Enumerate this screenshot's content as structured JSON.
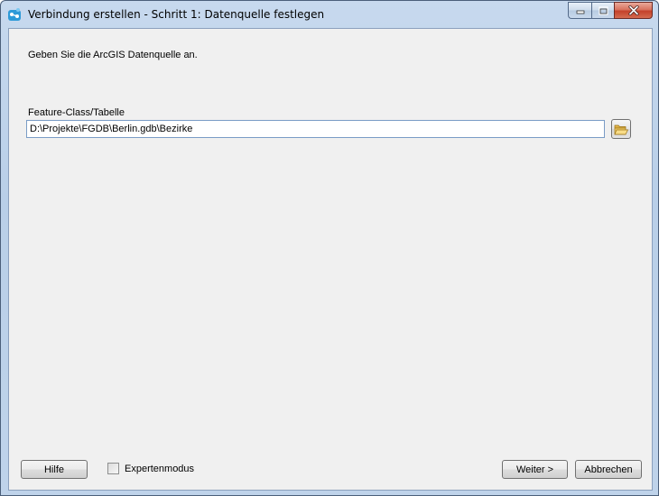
{
  "window": {
    "title": "Verbindung erstellen - Schritt 1: Datenquelle festlegen"
  },
  "caption": {
    "minimize_icon": "minimize-icon",
    "maximize_icon": "maximize-icon",
    "close_icon": "close-icon"
  },
  "content": {
    "intro_text": "Geben Sie die ArcGIS Datenquelle an.",
    "field_label": "Feature-Class/Tabelle",
    "path_value": "D:\\Projekte\\FGDB\\Berlin.gdb\\Bezirke",
    "browse_icon": "folder-open-icon"
  },
  "footer": {
    "help_label": "Hilfe",
    "expert_mode_label": "Expertenmodus",
    "expert_mode_checked": false,
    "next_label": "Weiter >",
    "cancel_label": "Abbrechen"
  },
  "colors": {
    "frame": "#bfd3ea",
    "client_bg": "#f0f0f0",
    "input_border": "#7a9cc6",
    "close_button": "#c4412a"
  }
}
